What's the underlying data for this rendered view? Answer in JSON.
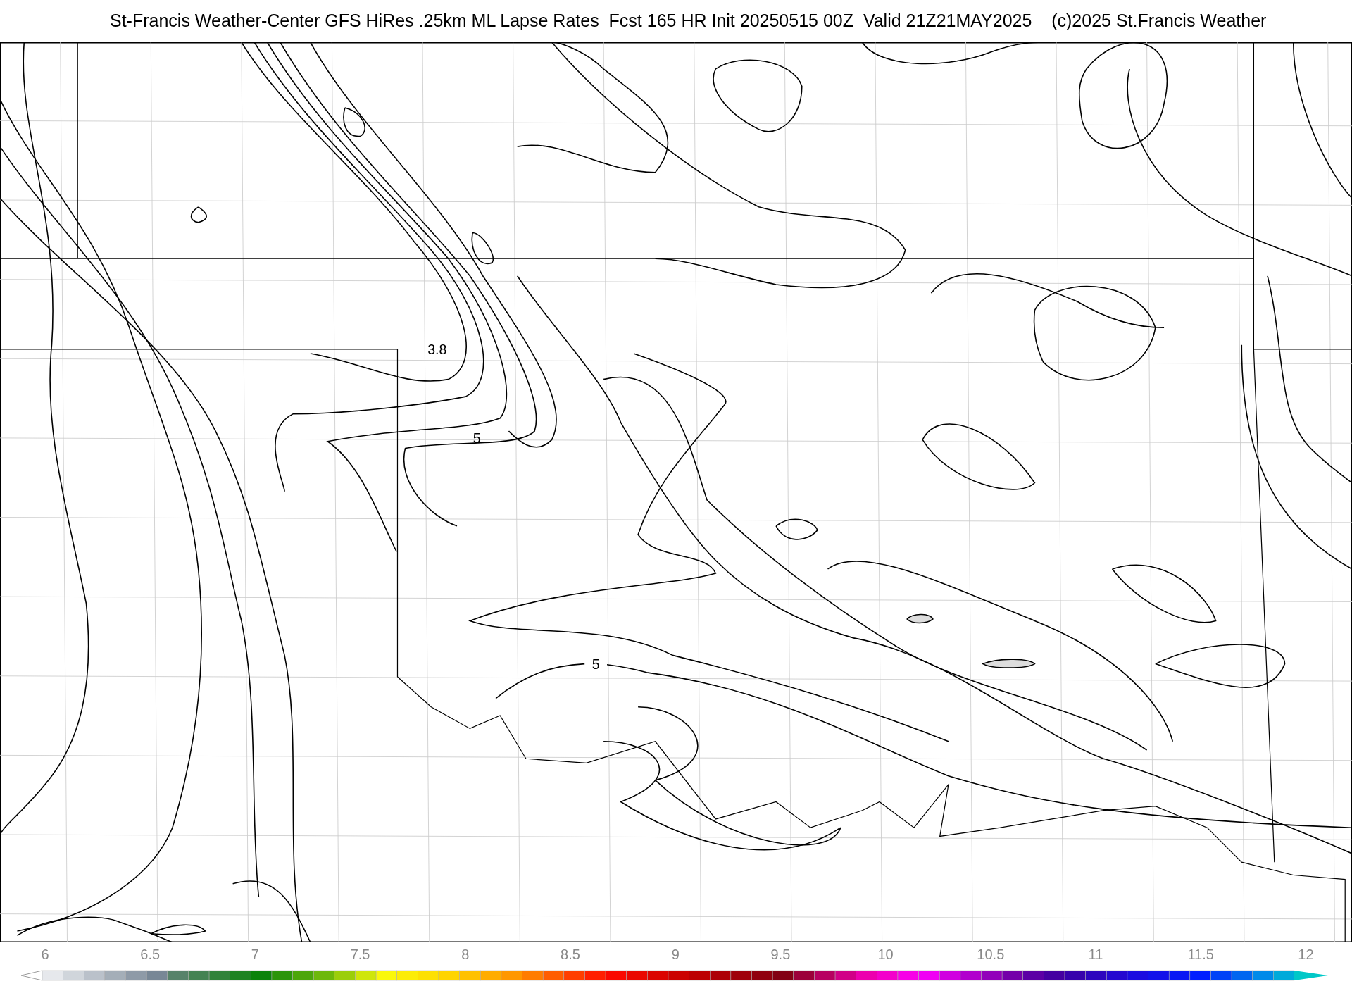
{
  "title": "St-Francis Weather-Center GFS HiRes .25km ML Lapse Rates  Fcst 165 HR Init 20250515 00Z  Valid 21Z21MAY2025    (c)2025 St.Francis Weather",
  "contour_labels": [
    "3.8",
    "5",
    "5"
  ],
  "colorbar": {
    "ticks": [
      "6",
      "6.5",
      "7",
      "7.5",
      "8",
      "8.5",
      "9",
      "9.5",
      "10",
      "10.5",
      "11",
      "11.5",
      "12"
    ]
  }
}
